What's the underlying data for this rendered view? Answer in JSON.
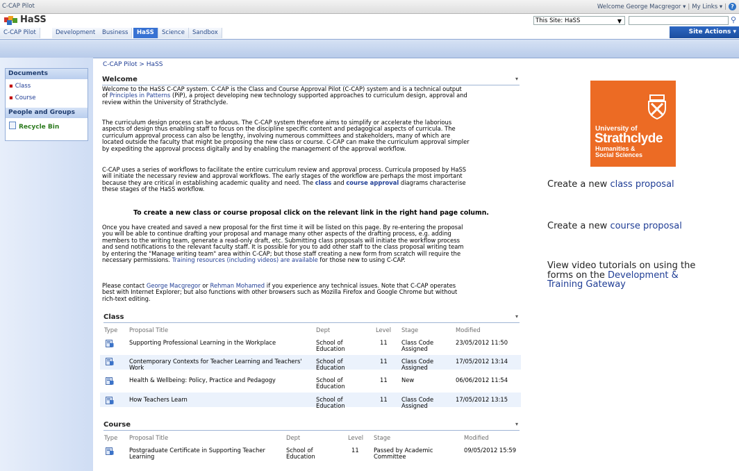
{
  "topbar": {
    "site": "C-CAP Pilot",
    "welcome": "Welcome George Macgregor ▾",
    "mylinks": "My Links ▾",
    "sep": "|"
  },
  "header": {
    "title": "HaSS",
    "search_scope": "This Site: HaSS",
    "site_actions": "Site Actions ▾"
  },
  "tabs": [
    "C-CAP Pilot",
    "Development",
    "Business",
    "HaSS",
    "Science",
    "Sandbox"
  ],
  "quicklaunch": {
    "documents": "Documents",
    "doc_items": [
      "Class",
      "Course"
    ],
    "people": "People and Groups",
    "recycle": "Recycle Bin"
  },
  "breadcrumb": "C-CAP Pilot > HaSS",
  "welcome": {
    "heading": "Welcome",
    "p1a": "Welcome to the HaSS C-CAP system.  C-CAP is the Class and Course Approval Pilot (C-CAP) system and is a technical output",
    "p1b_link": "Principles in Patterns",
    "p1b_of": "of ",
    "p1b": " (PiP), a project developing new technology supported approaches to curriculum design, approval and",
    "p1c": "review within the University of Strathclyde.",
    "p2": [
      "The curriculum design process can be arduous.  The C-CAP system therefore aims to simplify or accelerate the laborious",
      "aspects of design thus enabling staff to focus on the discipline specific content and pedagogical aspects of curricula.  The",
      "curriculum approval process can also be lengthy, involving numerous committees and stakeholders, many of which are",
      "located outside the faculty that might be proposing the new class or course.  C-CAP can make the curriculum approval simpler",
      "by expediting the approval process digitally and by enabling the management of the approval workflow."
    ],
    "p3": [
      "C-CAP uses a series of workflows to facilitate the entire curriculum review and approval process.  Curricula proposed by HaSS",
      "will initiate the necessary review and approval workflows.  The early stages of the workflow are perhaps the most important"
    ],
    "p3c_a": "because they are critical in establishing academic quality and need.  The ",
    "p3c_class": "class",
    "p3c_and": " and ",
    "p3c_course": "course approval",
    "p3c_b": " diagrams characterise",
    "p3d": "these stages of the HaSS workflow.",
    "bold_line": "To create a new class or course proposal click on the relevant link in the right hand page column.",
    "p4": [
      "Once you have created and saved a new proposal for the first time it will be listed on this page.  By re-entering the proposal",
      "you will be able to continue drafting your proposal and manage many other aspects of the drafting process, e.g. adding",
      "members to the writing team, generate a read-only draft, etc.  Submitting class proposals will initiate the workflow process",
      "and send notifications to the relevant faculty staff.  It is possible for you to add other staff to the class proposal writing team",
      "by entering the \"Manage writing team\" area within C-CAP; but those staff creating a new form from scratch will require the"
    ],
    "p4f_a": "necessary permissions. ",
    "p4f_link": "Training resources (including videos) are available",
    "p4f_b": " for those new to using C-CAP.",
    "p5a_a": "Please contact ",
    "p5a_l1": "George Macgregor",
    "p5a_or": " or ",
    "p5a_l2": "Rehman Mohamed",
    "p5a_b": " if you experience any technical issues.  Note that C-CAP operates",
    "p5b": "best with Internet Explorer; but also functions with other browsers such as Mozilla Firefox and Google Chrome but without",
    "p5c": "rich-text editing."
  },
  "class_list": {
    "heading": "Class",
    "columns": [
      "Type",
      "Proposal Title",
      "Dept",
      "Level",
      "Stage",
      "Modified"
    ],
    "rows": [
      {
        "title": [
          "Supporting Professional Learning in the Workplace",
          ""
        ],
        "dept": [
          "School of",
          "Education"
        ],
        "level": "11",
        "stage": [
          "Class Code",
          "Assigned"
        ],
        "modified": "23/05/2012 11:50"
      },
      {
        "title": [
          "Contemporary Contexts for Teacher Learning and Teachers'",
          "Work"
        ],
        "dept": [
          "School of",
          "Education"
        ],
        "level": "11",
        "stage": [
          "Class Code",
          "Assigned"
        ],
        "modified": "17/05/2012 13:14"
      },
      {
        "title": [
          "Health & Wellbeing: Policy, Practice and Pedagogy",
          ""
        ],
        "dept": [
          "School of",
          "Education"
        ],
        "level": "11",
        "stage": [
          "New",
          ""
        ],
        "modified": "06/06/2012 11:54"
      },
      {
        "title": [
          "How Teachers Learn",
          ""
        ],
        "dept": [
          "School of",
          "Education"
        ],
        "level": "11",
        "stage": [
          "Class Code",
          "Assigned"
        ],
        "modified": "17/05/2012 13:15"
      }
    ]
  },
  "course_list": {
    "heading": "Course",
    "columns": [
      "Type",
      "Proposal Title",
      "Dept",
      "Level",
      "Stage",
      "Modified"
    ],
    "rows": [
      {
        "title": [
          "Postgraduate Certificate in Supporting Teacher",
          "Learning"
        ],
        "dept": [
          "School of",
          "Education"
        ],
        "level": "11",
        "stage": [
          "Passed by Academic",
          "Committee"
        ],
        "modified": "09/05/2012 15:59"
      }
    ]
  },
  "logo": {
    "line1": "University of",
    "line2": "Strathclyde",
    "line3": "Humanities &",
    "line4": "Social Sciences",
    "color": "#ec6b24"
  },
  "rightpanel": {
    "class_pre": "Create a new ",
    "class_link": "class proposal",
    "course_pre": "Create a new ",
    "course_link": "course proposal",
    "video_l1": "View video tutorials on using the",
    "video_l2_pre": "forms on the ",
    "video_l2_link": "Development &",
    "video_l3_link": "Training Gateway"
  }
}
